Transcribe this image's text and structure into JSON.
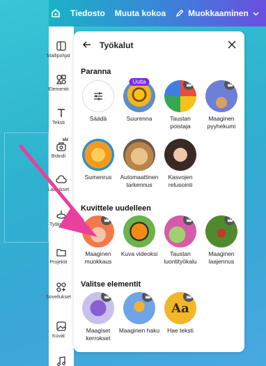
{
  "topbar": {
    "file": "Tiedosto",
    "resize": "Muuta kokoa",
    "edit": "Muokkaaminen"
  },
  "rail": {
    "items": [
      {
        "label": "Mallipohjat"
      },
      {
        "label": "Elementit"
      },
      {
        "label": "Teksti"
      },
      {
        "label": "Brändi"
      },
      {
        "label": "Lataukset"
      },
      {
        "label": "Työkalut"
      },
      {
        "label": "Projektit"
      },
      {
        "label": "Sovellukset"
      },
      {
        "label": "Kuvat"
      },
      {
        "label": ""
      }
    ]
  },
  "panel": {
    "title": "Työkalut",
    "sections": {
      "improve": "Paranna",
      "reimagine": "Kuvittele uudelleen",
      "select": "Valitse elementit"
    },
    "tools": {
      "adjust": "Säädä",
      "enlarge": "Suurenna",
      "enlarge_badge": "Uutta",
      "bg_remove": "Taustan poistaja",
      "magic_eraser": "Maaginen pyyhekumi",
      "blur": "Sumenrus",
      "autofocus": "Automaattinen tarkennus",
      "face_retouch": "Kasvojen retusointi",
      "magic_edit": "Maaginen muokkaus",
      "image_to_video": "Kuva videoksi",
      "bg_generator": "Taustan luontityökalu",
      "magic_expand": "Maaginen laajennus",
      "magic_layers": "Maagiset kerrokset",
      "magic_search": "Maaginen haku",
      "grab_text": "Hae teksti"
    }
  },
  "colors": {
    "accent_pink": "#e8409c",
    "crown": "#555555",
    "new_badge": "#7d2ae8"
  }
}
